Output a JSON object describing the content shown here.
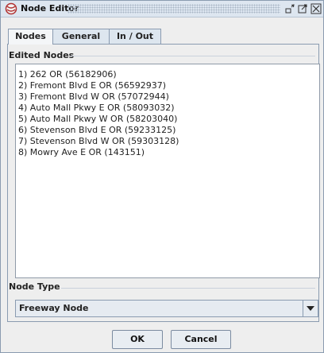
{
  "window": {
    "title": "Node Editor",
    "icons": [
      "app-icon",
      "minimize-icon",
      "maximize-icon",
      "close-icon"
    ]
  },
  "tabs": [
    {
      "label": "Nodes",
      "active": true
    },
    {
      "label": "General",
      "active": false
    },
    {
      "label": "In / Out",
      "active": false
    }
  ],
  "edited_nodes": {
    "label": "Edited Nodes",
    "items": [
      "1) 262 OR (56182906)",
      "2) Fremont Blvd E OR (56592937)",
      "3) Fremont Blvd W OR (57072944)",
      "4) Auto Mall Pkwy E OR (58093032)",
      "5) Auto Mall Pkwy W OR (58203040)",
      "6) Stevenson Blvd E OR (59233125)",
      "7) Stevenson Blvd W OR (59303128)",
      "8) Mowry Ave E OR (143151)"
    ]
  },
  "node_type": {
    "label": "Node Type",
    "selected": "Freeway Node"
  },
  "buttons": {
    "ok": "OK",
    "cancel": "Cancel"
  }
}
